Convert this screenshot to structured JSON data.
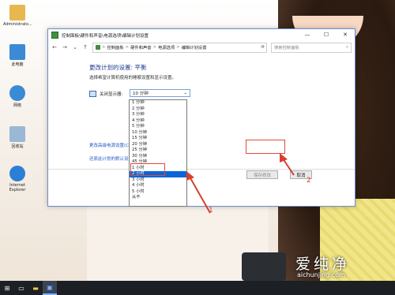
{
  "desktop": {
    "icons": [
      {
        "label": "Administrato...",
        "icon": "user-folder-icon",
        "color": "#e6b84d"
      },
      {
        "label": "此电脑",
        "icon": "computer-icon",
        "color": "#3a8ad6"
      },
      {
        "label": "网络",
        "icon": "network-icon",
        "color": "#3a8ad6"
      },
      {
        "label": "回收站",
        "icon": "recycle-bin-icon",
        "color": "#9ab8d6"
      },
      {
        "label": "Internet Explorer",
        "icon": "internet-explorer-icon",
        "color": "#2d7fd6"
      }
    ]
  },
  "window": {
    "title": "控制面板\\硬件和声音\\电源选项\\编辑计划设置",
    "controls": {
      "minimize": "—",
      "maximize": "☐",
      "close": "✕"
    },
    "address": {
      "crumbs": [
        "控制面板",
        "硬件和声音",
        "电源选项",
        "编辑计划设置"
      ],
      "separator": ">"
    },
    "search_placeholder": "搜索控制面板",
    "heading": "更改计划的设置: 平衡",
    "subtitle": "选择希望计算机使用的睡眠设置和显示设置。",
    "display_off_label": "关闭显示器:",
    "display_off_value": "10 分钟",
    "link_advanced": "更改高级电源设置(C)",
    "link_restore": "还原此计划的默认设置(R)",
    "save_button": "保存修改",
    "cancel_button": "取消"
  },
  "dropdown": {
    "options": [
      "1 分钟",
      "2 分钟",
      "3 分钟",
      "4 分钟",
      "5 分钟",
      "10 分钟",
      "15 分钟",
      "20 分钟",
      "25 分钟",
      "30 分钟",
      "45 分钟",
      "1 小时",
      "2 小时",
      "3 小时",
      "4 小时",
      "5 小时",
      "从不"
    ],
    "selected": "2 小时"
  },
  "annotations": {
    "step1": "1",
    "step2": "2"
  },
  "accent_color": "#0a66d6",
  "annotation_color": "#e24a3a",
  "watermark": {
    "brand": "爱纯净",
    "url": "aichunjing.com"
  }
}
